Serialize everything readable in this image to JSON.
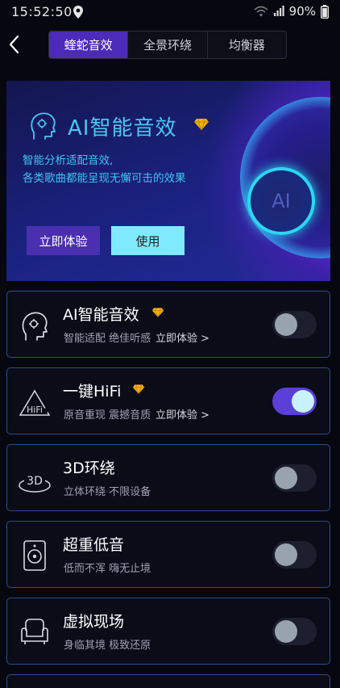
{
  "status": {
    "time": "15:52:50",
    "battery": "90%"
  },
  "tabs": [
    {
      "label": "蝰蛇音效",
      "active": true
    },
    {
      "label": "全景环绕",
      "active": false
    },
    {
      "label": "均衡器",
      "active": false
    }
  ],
  "banner": {
    "title": "AI智能音效",
    "desc_line1": "智能分析适配音效,",
    "desc_line2": "各类歌曲都能呈现无懈可击的效果",
    "try_label": "立即体验",
    "use_label": "使用",
    "disc_label": "AI"
  },
  "effects": [
    {
      "title": "AI智能音效",
      "subtitle": "智能适配 绝佳听感",
      "link": "立即体验 >",
      "enabled": false,
      "icon": "ai-head-icon",
      "premium": true
    },
    {
      "title": "一键HiFi",
      "subtitle": "原音重现 震撼音质",
      "link": "立即体验 >",
      "enabled": true,
      "icon": "hifi-icon",
      "premium": true
    },
    {
      "title": "3D环绕",
      "subtitle": "立体环绕 不限设备",
      "link": "",
      "enabled": false,
      "icon": "surround-3d-icon",
      "premium": false
    },
    {
      "title": "超重低音",
      "subtitle": "低而不浑 嗨无止境",
      "link": "",
      "enabled": false,
      "icon": "speaker-icon",
      "premium": false
    },
    {
      "title": "虚拟现场",
      "subtitle": "身临其境 极致还原",
      "link": "",
      "enabled": false,
      "icon": "armchair-icon",
      "premium": false
    }
  ],
  "colors": {
    "accent": "#4b2bb8",
    "toggle_on": "#5a3fd8",
    "cyan": "#48c8f0",
    "card_border": "#2b4d8a"
  }
}
